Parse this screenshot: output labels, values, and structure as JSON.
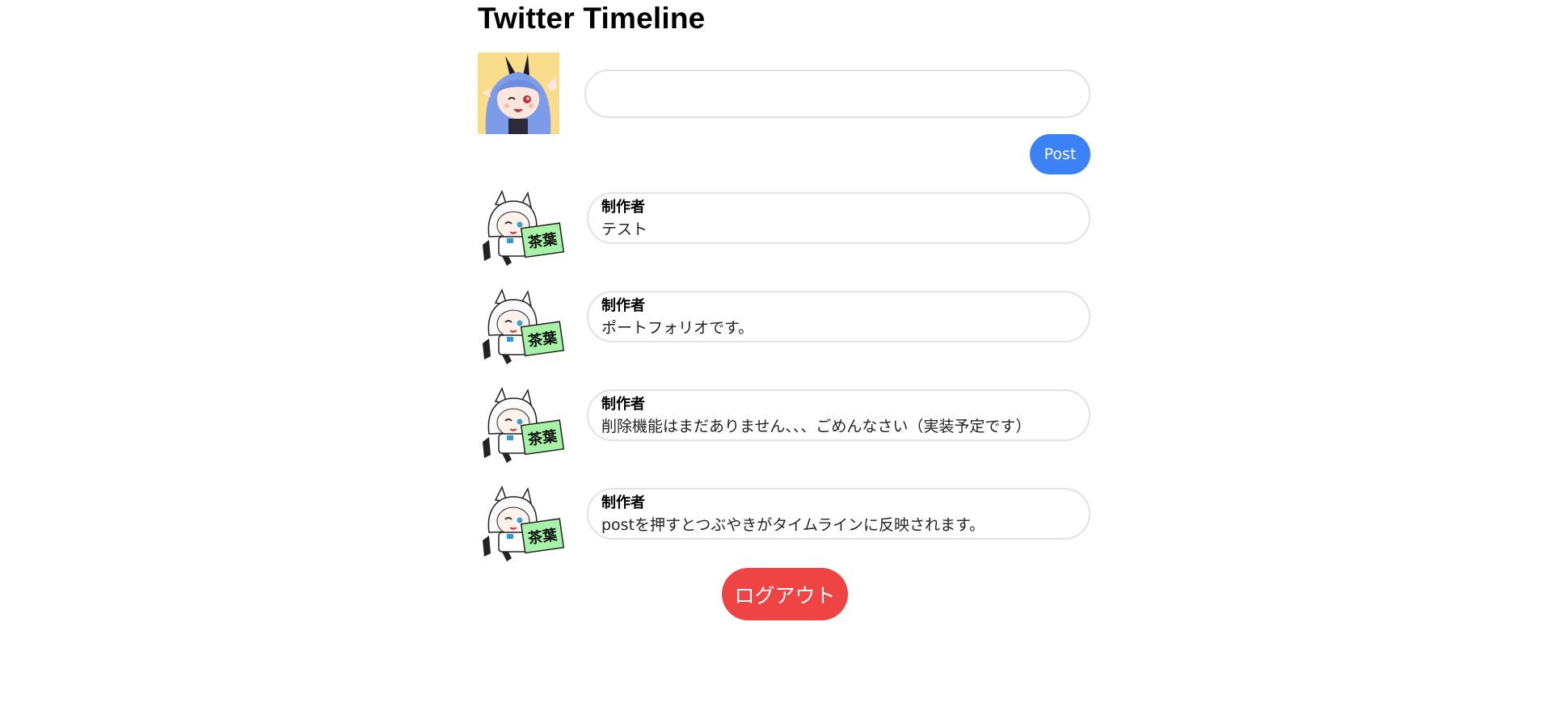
{
  "header": {
    "title": "Twitter Timeline"
  },
  "composer": {
    "input_value": "",
    "input_placeholder": "",
    "post_label": "Post"
  },
  "timeline": {
    "posts": [
      {
        "author": "制作者",
        "text": "テスト"
      },
      {
        "author": "制作者",
        "text": "ポートフォリオです。"
      },
      {
        "author": "制作者",
        "text": "削除機能はまだありません、、、ごめんなさい（実装予定です）"
      },
      {
        "author": "制作者",
        "text": "postを押すとつぶやきがタイムラインに反映されます。"
      }
    ],
    "avatar_sign_text": "茶葉"
  },
  "footer": {
    "logout_label": "ログアウト"
  },
  "colors": {
    "post_button": "#3b82f6",
    "logout_button": "#ef4444",
    "border": "#e2e2e2"
  },
  "icons": {
    "user_avatar": "anime-bunny-girl-avatar",
    "post_avatar": "anime-cat-girl-avatar"
  }
}
